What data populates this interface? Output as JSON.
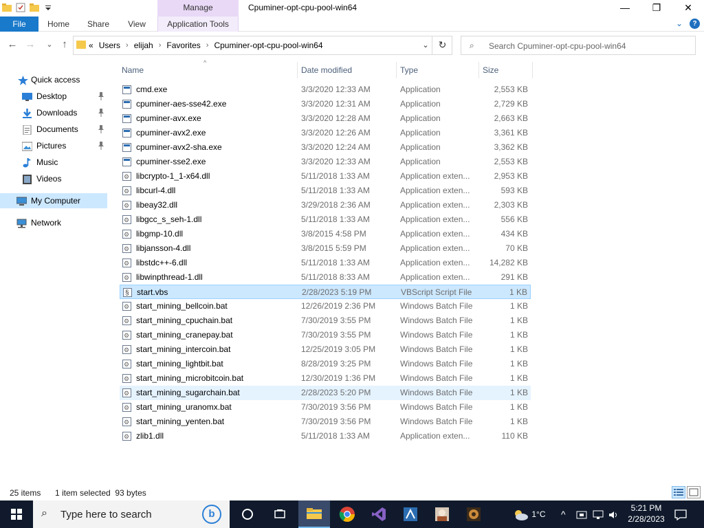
{
  "window": {
    "title": "Cpuminer-opt-cpu-pool-win64",
    "manage_label": "Manage",
    "minimize": "—",
    "maximize": "❐",
    "close": "✕"
  },
  "ribbon": {
    "tabs": [
      "File",
      "Home",
      "Share",
      "View",
      "Application Tools"
    ],
    "expand_icon": "⌄",
    "help_icon": "?"
  },
  "address": {
    "prefix": "«",
    "crumbs": [
      "Users",
      "elijah",
      "Favorites",
      "Cpuminer-opt-cpu-pool-win64"
    ],
    "separator": "›",
    "dropdown": "⌄",
    "refresh": "↻",
    "back": "←",
    "forward": "→",
    "recent": "⌄",
    "up": "↑"
  },
  "search": {
    "placeholder": "Search Cpuminer-opt-cpu-pool-win64",
    "icon": "⌕"
  },
  "nav": {
    "items": [
      {
        "label": "Quick access",
        "icon": "star-icon",
        "pinned": false
      },
      {
        "label": "Desktop",
        "icon": "desktop-icon",
        "pinned": true
      },
      {
        "label": "Downloads",
        "icon": "download-icon",
        "pinned": true
      },
      {
        "label": "Documents",
        "icon": "documents-icon",
        "pinned": true
      },
      {
        "label": "Pictures",
        "icon": "pictures-icon",
        "pinned": true
      },
      {
        "label": "Music",
        "icon": "music-icon",
        "pinned": false
      },
      {
        "label": "Videos",
        "icon": "videos-icon",
        "pinned": false
      },
      {
        "label": "My Computer",
        "icon": "computer-icon",
        "pinned": false
      },
      {
        "label": "Network",
        "icon": "network-icon",
        "pinned": false
      }
    ],
    "pin_glyph": "📌"
  },
  "columns": {
    "name": "Name",
    "date": "Date modified",
    "type": "Type",
    "size": "Size",
    "sort_arrow": "^"
  },
  "files": [
    {
      "name": "cmd.exe",
      "date": "3/3/2020 12:33 AM",
      "type": "Application",
      "size": "2,553 KB",
      "kind": "exe"
    },
    {
      "name": "cpuminer-aes-sse42.exe",
      "date": "3/3/2020 12:31 AM",
      "type": "Application",
      "size": "2,729 KB",
      "kind": "exe"
    },
    {
      "name": "cpuminer-avx.exe",
      "date": "3/3/2020 12:28 AM",
      "type": "Application",
      "size": "2,663 KB",
      "kind": "exe"
    },
    {
      "name": "cpuminer-avx2.exe",
      "date": "3/3/2020 12:26 AM",
      "type": "Application",
      "size": "3,361 KB",
      "kind": "exe"
    },
    {
      "name": "cpuminer-avx2-sha.exe",
      "date": "3/3/2020 12:24 AM",
      "type": "Application",
      "size": "3,362 KB",
      "kind": "exe"
    },
    {
      "name": "cpuminer-sse2.exe",
      "date": "3/3/2020 12:33 AM",
      "type": "Application",
      "size": "2,553 KB",
      "kind": "exe"
    },
    {
      "name": "libcrypto-1_1-x64.dll",
      "date": "5/11/2018 1:33 AM",
      "type": "Application exten...",
      "size": "2,953 KB",
      "kind": "dll"
    },
    {
      "name": "libcurl-4.dll",
      "date": "5/11/2018 1:33 AM",
      "type": "Application exten...",
      "size": "593 KB",
      "kind": "dll"
    },
    {
      "name": "libeay32.dll",
      "date": "3/29/2018 2:36 AM",
      "type": "Application exten...",
      "size": "2,303 KB",
      "kind": "dll"
    },
    {
      "name": "libgcc_s_seh-1.dll",
      "date": "5/11/2018 1:33 AM",
      "type": "Application exten...",
      "size": "556 KB",
      "kind": "dll"
    },
    {
      "name": "libgmp-10.dll",
      "date": "3/8/2015 4:58 PM",
      "type": "Application exten...",
      "size": "434 KB",
      "kind": "dll"
    },
    {
      "name": "libjansson-4.dll",
      "date": "3/8/2015 5:59 PM",
      "type": "Application exten...",
      "size": "70 KB",
      "kind": "dll"
    },
    {
      "name": "libstdc++-6.dll",
      "date": "5/11/2018 1:33 AM",
      "type": "Application exten...",
      "size": "14,282 KB",
      "kind": "dll"
    },
    {
      "name": "libwinpthread-1.dll",
      "date": "5/11/2018 8:33 AM",
      "type": "Application exten...",
      "size": "291 KB",
      "kind": "dll"
    },
    {
      "name": "start.vbs",
      "date": "2/28/2023 5:19 PM",
      "type": "VBScript Script File",
      "size": "1 KB",
      "kind": "vbs",
      "state": "selected"
    },
    {
      "name": "start_mining_bellcoin.bat",
      "date": "12/26/2019 2:36 PM",
      "type": "Windows Batch File",
      "size": "1 KB",
      "kind": "bat"
    },
    {
      "name": "start_mining_cpuchain.bat",
      "date": "7/30/2019 3:55 PM",
      "type": "Windows Batch File",
      "size": "1 KB",
      "kind": "bat"
    },
    {
      "name": "start_mining_cranepay.bat",
      "date": "7/30/2019 3:55 PM",
      "type": "Windows Batch File",
      "size": "1 KB",
      "kind": "bat"
    },
    {
      "name": "start_mining_intercoin.bat",
      "date": "12/25/2019 3:05 PM",
      "type": "Windows Batch File",
      "size": "1 KB",
      "kind": "bat"
    },
    {
      "name": "start_mining_lightbit.bat",
      "date": "8/28/2019 3:25 PM",
      "type": "Windows Batch File",
      "size": "1 KB",
      "kind": "bat"
    },
    {
      "name": "start_mining_microbitcoin.bat",
      "date": "12/30/2019 1:36 PM",
      "type": "Windows Batch File",
      "size": "1 KB",
      "kind": "bat"
    },
    {
      "name": "start_mining_sugarchain.bat",
      "date": "2/28/2023 5:20 PM",
      "type": "Windows Batch File",
      "size": "1 KB",
      "kind": "bat",
      "state": "hover"
    },
    {
      "name": "start_mining_uranomx.bat",
      "date": "7/30/2019 3:56 PM",
      "type": "Windows Batch File",
      "size": "1 KB",
      "kind": "bat"
    },
    {
      "name": "start_mining_yenten.bat",
      "date": "7/30/2019 3:56 PM",
      "type": "Windows Batch File",
      "size": "1 KB",
      "kind": "bat"
    },
    {
      "name": "zlib1.dll",
      "date": "5/11/2018 1:33 AM",
      "type": "Application exten...",
      "size": "110 KB",
      "kind": "dll"
    }
  ],
  "status": {
    "items": "25 items",
    "selected": "1 item selected  93 bytes"
  },
  "taskbar": {
    "search_placeholder": "Type here to search",
    "search_icon": "⌕",
    "bing_label": "b",
    "apps": [
      "task-view-icon",
      "cortana-icon",
      "file-explorer-icon",
      "chrome-icon",
      "visual-studio-icon",
      "app-icon",
      "game-icon-1",
      "game-icon-2"
    ],
    "weather": "1°C",
    "tray_up": "^",
    "time": "5:21 PM",
    "date": "2/28/2023"
  },
  "colors": {
    "accent": "#1979ca",
    "selection": "#cce8ff",
    "taskbar": "#101a2c",
    "manage_tab": "#e9d9f7"
  }
}
